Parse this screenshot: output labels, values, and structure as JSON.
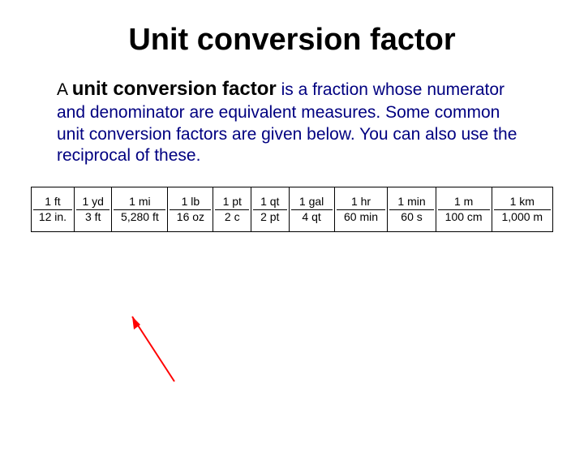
{
  "title": "Unit conversion factor",
  "body": {
    "lead_a": "A ",
    "term": "unit conversion factor",
    "rest": " is a fraction whose numerator and denominator are equivalent measures.  Some common unit conversion factors are given below.  You can also use the reciprocal of these."
  },
  "factors": [
    {
      "num": "1 ft",
      "den": "12 in."
    },
    {
      "num": "1 yd",
      "den": "3 ft"
    },
    {
      "num": "1 mi",
      "den": "5,280 ft"
    },
    {
      "num": "1 lb",
      "den": "16 oz"
    },
    {
      "num": "1 pt",
      "den": "2 c"
    },
    {
      "num": "1 qt",
      "den": "2 pt"
    },
    {
      "num": "1 gal",
      "den": "4 qt"
    },
    {
      "num": "1 hr",
      "den": "60 min"
    },
    {
      "num": "1 min",
      "den": "60 s"
    },
    {
      "num": "1 m",
      "den": "100 cm"
    },
    {
      "num": "1 km",
      "den": "1,000 m"
    }
  ]
}
